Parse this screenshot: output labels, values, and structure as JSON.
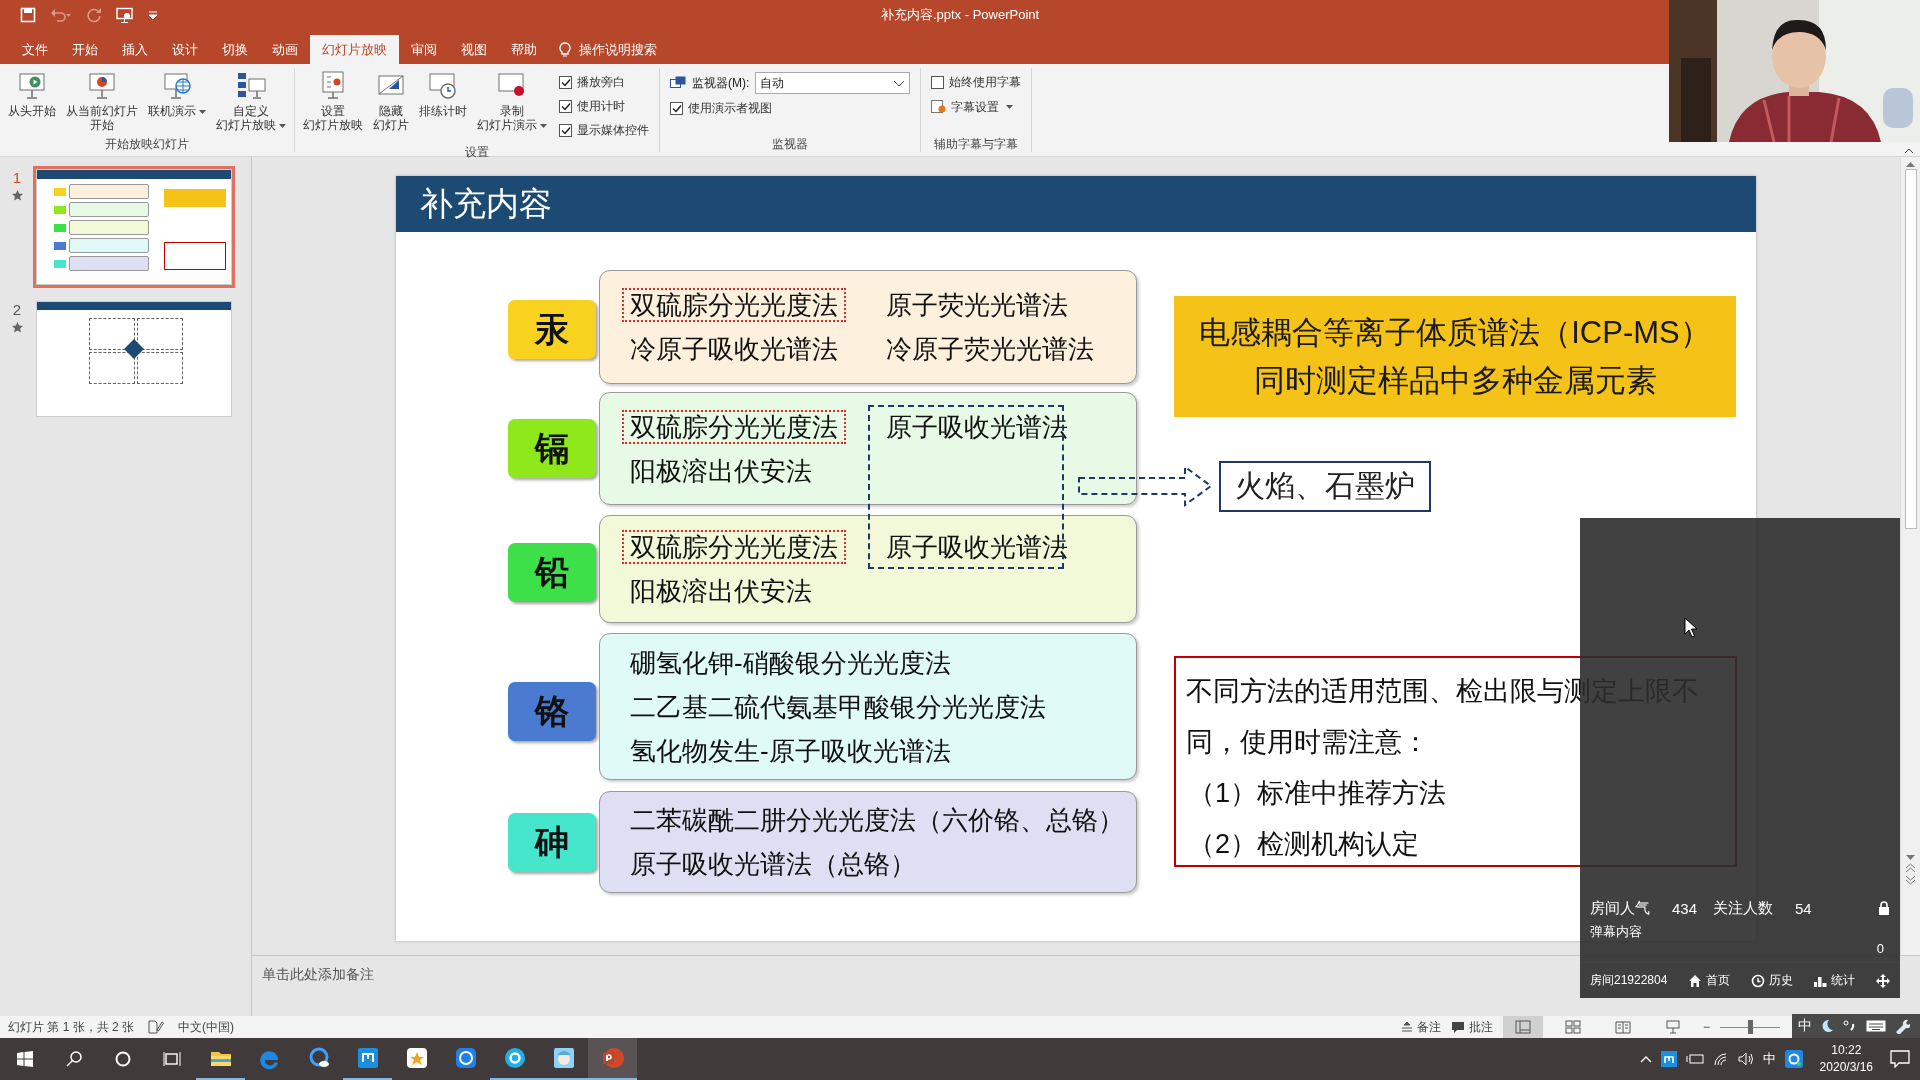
{
  "title_bar": {
    "title": "补充内容.pptx  -  PowerPoint",
    "quick_access": [
      {
        "disabled": false
      },
      {
        "disabled": true
      },
      {
        "disabled": true
      },
      {
        "disabled": false
      }
    ]
  },
  "ribbon": {
    "tabs": [
      {
        "label": "文件",
        "selected": false
      },
      {
        "label": "开始",
        "selected": false
      },
      {
        "label": "插入",
        "selected": false
      },
      {
        "label": "设计",
        "selected": false
      },
      {
        "label": "切换",
        "selected": false
      },
      {
        "label": "动画",
        "selected": false
      },
      {
        "label": "幻灯片放映",
        "selected": true
      },
      {
        "label": "审阅",
        "selected": false
      },
      {
        "label": "视图",
        "selected": false
      },
      {
        "label": "帮助",
        "selected": false
      }
    ],
    "tell_me": "操作说明搜索",
    "groups": [
      {
        "label": "开始放映幻灯片",
        "items": [
          {
            "kind": "large",
            "lines": [
              "从头开始"
            ],
            "dropdown": false
          },
          {
            "kind": "large",
            "lines": [
              "从当前幻灯片",
              "开始"
            ],
            "dropdown": false
          },
          {
            "kind": "large",
            "lines": [
              "联机演示"
            ],
            "dropdown": true
          },
          {
            "kind": "large",
            "lines": [
              "自定义",
              "幻灯片放映"
            ],
            "dropdown": true
          }
        ]
      },
      {
        "label": "设置",
        "items": [
          {
            "kind": "large",
            "lines": [
              "设置",
              "幻灯片放映"
            ],
            "dropdown": false
          },
          {
            "kind": "large",
            "lines": [
              "隐藏",
              "幻灯片"
            ],
            "dropdown": false
          },
          {
            "kind": "large",
            "lines": [
              "排练计时"
            ],
            "dropdown": false
          },
          {
            "kind": "large",
            "lines": [
              "录制",
              "幻灯片演示"
            ],
            "dropdown": true
          },
          {
            "kind": "checkbox",
            "label": "播放旁白",
            "checked": true
          },
          {
            "kind": "checkbox",
            "label": "使用计时",
            "checked": true
          },
          {
            "kind": "checkbox",
            "label": "显示媒体控件",
            "checked": true
          }
        ]
      },
      {
        "label": "监视器",
        "items": [
          {
            "kind": "select",
            "label": "监视器(M):",
            "value": "自动"
          },
          {
            "kind": "checkbox",
            "label": "使用演示者视图",
            "checked": true
          }
        ]
      },
      {
        "label": "辅助字幕与字幕",
        "items": [
          {
            "kind": "checkbox",
            "label": "始终使用字幕",
            "checked": false
          },
          {
            "kind": "small",
            "label": "字幕设置",
            "dropdown": true
          }
        ]
      }
    ]
  },
  "thumbnails": [
    {
      "number": "1",
      "selected": true,
      "animated": true
    },
    {
      "number": "2",
      "selected": false,
      "animated": true
    }
  ],
  "slide": {
    "title": "补充内容",
    "elements": [
      {
        "symbol": "汞",
        "color": "#f7d21e",
        "rows": [
          [
            {
              "text": "双硫腙分光光度法",
              "framed": true
            },
            {
              "text": "原子荧光光谱法",
              "framed": false
            }
          ],
          [
            {
              "text": "冷原子吸收光谱法",
              "framed": false
            },
            {
              "text": "冷原子荧光光谱法",
              "framed": false
            }
          ]
        ]
      },
      {
        "symbol": "镉",
        "color": "#8ee81c",
        "rows": [
          [
            {
              "text": "双硫腙分光光度法",
              "framed": true
            },
            {
              "text": "原子吸收光谱法",
              "framed": false
            }
          ],
          [
            {
              "text": "阳极溶出伏安法",
              "framed": false
            }
          ]
        ]
      },
      {
        "symbol": "铅",
        "color": "#3ee04a",
        "rows": [
          [
            {
              "text": "双硫腙分光光度法",
              "framed": true
            },
            {
              "text": "原子吸收光谱法",
              "framed": false
            }
          ],
          [
            {
              "text": "阳极溶出伏安法",
              "framed": false
            }
          ]
        ]
      },
      {
        "symbol": "铬",
        "color": "#4a7bd0",
        "rows": [
          [
            {
              "text": "硼氢化钾-硝酸银分光光度法",
              "framed": false
            }
          ],
          [
            {
              "text": "二乙基二硫代氨基甲酸银分光光度法",
              "framed": false
            }
          ],
          [
            {
              "text": "氢化物发生-原子吸收光谱法",
              "framed": false
            }
          ]
        ]
      },
      {
        "symbol": "砷",
        "color": "#46e6cc",
        "rows": [
          [
            {
              "text": "二苯碳酰二肼分光光度法（六价铬、总铬）",
              "framed": false
            }
          ],
          [
            {
              "text": "原子吸收光谱法（总铬）",
              "framed": false
            }
          ]
        ]
      }
    ],
    "callout": "火焰、石墨炉",
    "highlight": {
      "lines": [
        "电感耦合等离子体质谱法（ICP-MS）",
        "同时测定样品中多种金属元素"
      ]
    },
    "remark": {
      "text": "不同方法的适用范围、检出限与测定上限不同，使用时需注意：",
      "points": [
        "（1）标准中推荐方法",
        "（2）检测机构认定"
      ]
    }
  },
  "notes": {
    "placeholder": "单击此处添加备注"
  },
  "status_bar": {
    "slide_info": "幻灯片 第 1 张，共 2 张",
    "language": "中文(中国)",
    "notes_button": "备注",
    "comments_button": "批注",
    "view_buttons": [
      {
        "selected": true
      },
      {
        "selected": false
      },
      {
        "selected": false
      },
      {
        "selected": false
      }
    ],
    "zoom_minus": "−",
    "zoom_slider": {
      "level": 0.5
    }
  },
  "ime_toolbar": {
    "mode": "中"
  },
  "stream_panel": {
    "stats": [
      {
        "label": "房间人气",
        "value": "434"
      },
      {
        "label": "关注人数",
        "value": "54"
      }
    ],
    "danmaku_label": "弹幕内容",
    "count": "0",
    "room": "房间21922804",
    "links": [
      "首页",
      "历史",
      "统计"
    ]
  },
  "taskbar": {
    "apps": [
      {
        "running": true,
        "active": false
      },
      {
        "running": false,
        "active": false
      },
      {
        "running": false,
        "active": false
      },
      {
        "running": true,
        "active": false
      },
      {
        "running": false,
        "active": false
      },
      {
        "running": false,
        "active": false
      },
      {
        "running": true,
        "active": false
      },
      {
        "running": true,
        "active": false
      },
      {
        "running": true,
        "active": true
      }
    ],
    "input_mode": "中",
    "time": "10:22",
    "date": "2020/3/16"
  }
}
